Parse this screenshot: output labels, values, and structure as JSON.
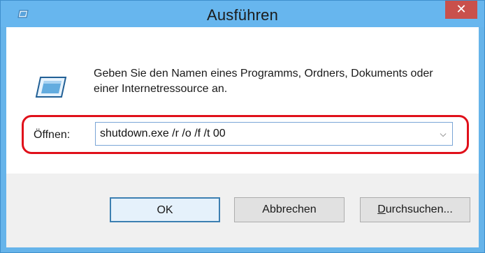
{
  "window": {
    "title": "Ausführen",
    "close_glyph": "✕",
    "accent_color": "#67b6ee",
    "close_color": "#c9504c"
  },
  "icons": {
    "title_icon": "run-icon",
    "content_icon": "run-icon",
    "combo_arrow": "chevron-down-icon"
  },
  "content": {
    "description": "Geben Sie den Namen eines Programms, Ordners, Dokuments oder einer Internetressource an.",
    "open_label": "Öffnen:",
    "open_value": "shutdown.exe /r /o /f /t 00",
    "highlight_color": "#e0101a"
  },
  "buttons": {
    "ok_label": "OK",
    "cancel_label": "Abbrechen",
    "browse_label_rest": "urchsuchen...",
    "browse_label_accel": "D"
  }
}
